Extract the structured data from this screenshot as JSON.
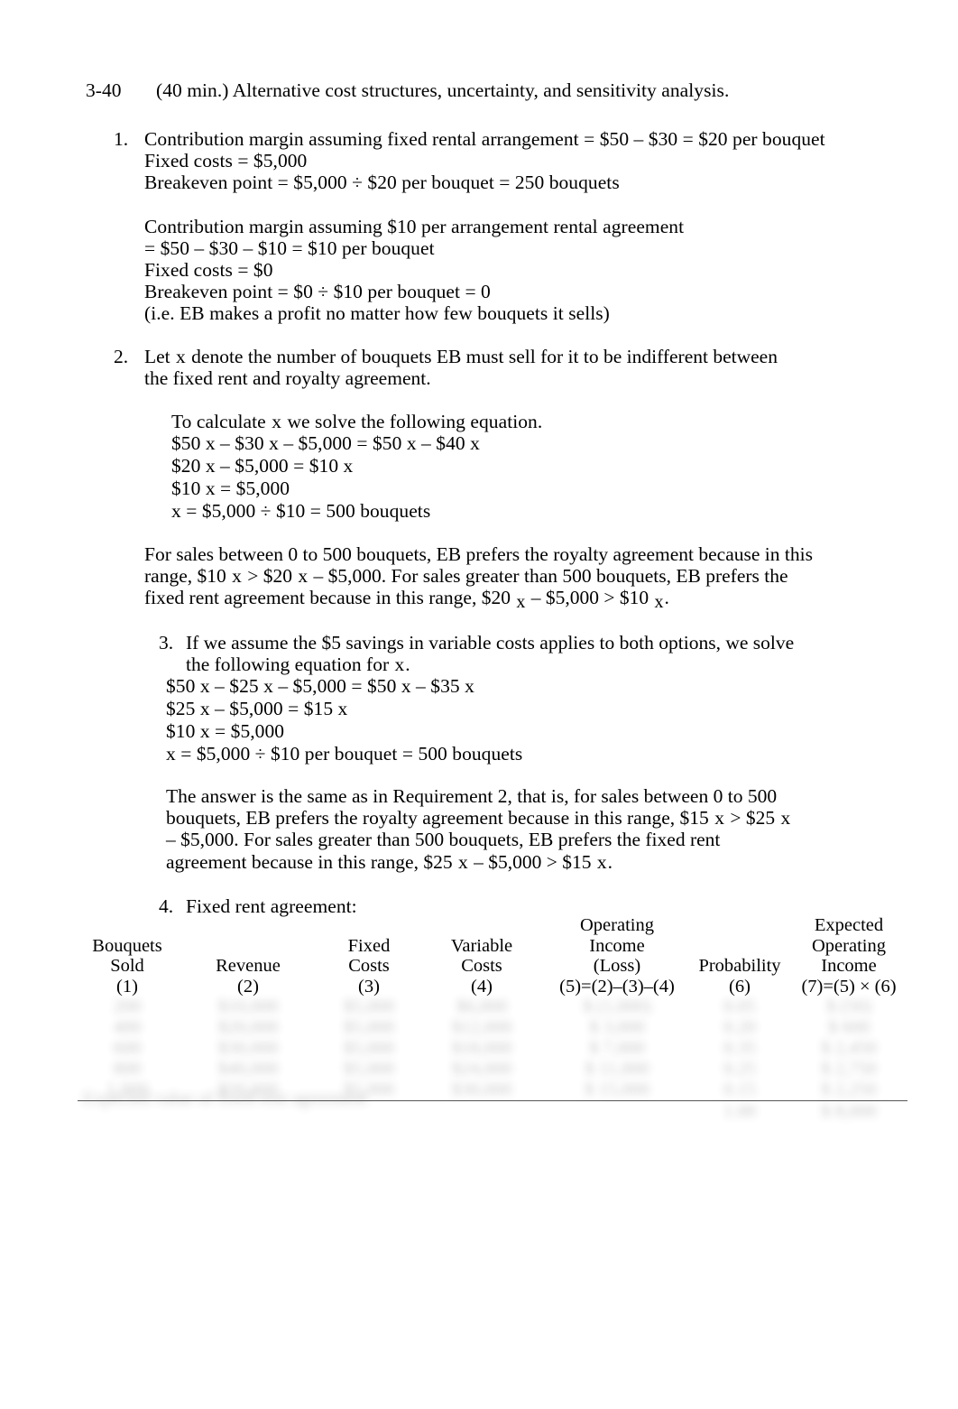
{
  "document": {
    "problem_number": "3-40",
    "title": "(40 min.) Alternative cost structures, uncertainty, and sensitivity analysis."
  },
  "item1": {
    "number": "1.",
    "line1": "Contribution margin assuming fixed rental arrangement = $50 – $30 = $20 per bouquet",
    "line2": "Fixed costs = $5,000",
    "line3": "Breakeven point = $5,000 ÷ $20 per bouquet = 250 bouquets",
    "line4": "Contribution margin assuming $10 per arrangement rental agreement",
    "line5": "= $50 – $30 – $10 = $10 per bouquet",
    "line6": "Fixed costs = $0",
    "line7": "Breakeven point = $0 ÷ $10 per bouquet = 0",
    "line8": "(i.e. EB makes a profit no matter how few bouquets it sells)"
  },
  "item2": {
    "number": "2.",
    "intro_a": "Let",
    "intro_var": "x",
    "intro_b": "denote the number of bouquets EB must sell for it to be indifferent between the fixed rent and royalty agreement.",
    "calc_a": "To calculate",
    "calc_var": "x",
    "calc_b": "we solve the following equation.",
    "eq1": "$50 x – $30 x  – $5,000 = $50 x – $40 x",
    "eq2": "$20 x  – $5,000 = $10 x",
    "eq3": "$10 x  = $5,000",
    "eq4": "x  = $5,000 ÷ $10 = 500 bouquets",
    "para_1": "For sales between 0 to 500 bouquets, EB prefers the royalty agreement because in this range, $10",
    "para_var1": "x",
    "para_2": "> $20",
    "para_var2": "x",
    "para_3": "– $5,000.  For sales greater than 500 bouquets, EB prefers the fixed rent agreement because in this range, $20",
    "para_var3": "x",
    "para_4": "– $5,000 > $10",
    "para_var4": "x",
    "para_5": "."
  },
  "item3": {
    "number": "3.",
    "line1_a": "If we assume the $5 savings in variable costs applies to both options, we solve the following equation for",
    "line1_var": "x",
    "line1_b": ".",
    "eq1": "$50 x – $25 x  – $5,000 = $50 x – $35 x",
    "eq2": "$25 x – $5,000 = $15 x",
    "eq3": "$10 x = $5,000",
    "eq4": "x = $5,000 ÷ $10 per bouquet = 500 bouquets",
    "para_1": "The answer is the same as in Requirement 2, that is, for sales between 0 to 500 bouquets, EB prefers the royalty agreement because in this range, $15",
    "para_var1": "x",
    "para_2": "> $25",
    "para_var2": "x",
    "para_3": "– $5,000.  For sales greater than 500 bouquets, EB prefers the fixed rent agreement because in this range, $25",
    "para_var3": "x",
    "para_4": "– $5,000 > $15",
    "para_var4": "x",
    "para_5": "."
  },
  "item4": {
    "number": "4.",
    "label": "Fixed rent agreement:"
  },
  "table": {
    "headers": [
      {
        "lines": [
          "Bouquets",
          "Sold",
          "(1)"
        ]
      },
      {
        "lines": [
          "Revenue",
          "(2)"
        ]
      },
      {
        "lines": [
          "Fixed",
          "Costs",
          "(3)"
        ]
      },
      {
        "lines": [
          "Variable",
          "Costs",
          "(4)"
        ]
      },
      {
        "lines": [
          "Operating",
          "Income",
          "(Loss)",
          "(5)=(2)–(3)–(4)"
        ]
      },
      {
        "lines": [
          "Probability",
          "(6)"
        ]
      },
      {
        "lines": [
          "Expected",
          "Operating",
          "Income",
          "(7)=(5) × (6)"
        ]
      }
    ],
    "redacted": true,
    "rows": [
      {
        "cells": [
          "200",
          "$10,000",
          "$5,000",
          "$6,000",
          "$ (1,000)",
          "0.05",
          "$ (50)"
        ]
      },
      {
        "cells": [
          "400",
          "$20,000",
          "$5,000",
          "$12,000",
          "$ 3,000",
          "0.20",
          "$ 600"
        ]
      },
      {
        "cells": [
          "600",
          "$30,000",
          "$5,000",
          "$18,000",
          "$ 7,000",
          "0.35",
          "$ 2,450"
        ]
      },
      {
        "cells": [
          "800",
          "$40,000",
          "$5,000",
          "$24,000",
          "$ 11,000",
          "0.25",
          "$ 2,750"
        ]
      },
      {
        "cells": [
          "1,000",
          "$50,000",
          "$5,000",
          "$30,000",
          "$ 15,000",
          "0.15",
          "$ 2,250"
        ]
      }
    ],
    "total_row": {
      "cells": [
        "",
        "",
        "",
        "",
        "",
        "1.00",
        "$ 8,000"
      ]
    },
    "footnote": "Expected value of fixed rent agreement"
  }
}
